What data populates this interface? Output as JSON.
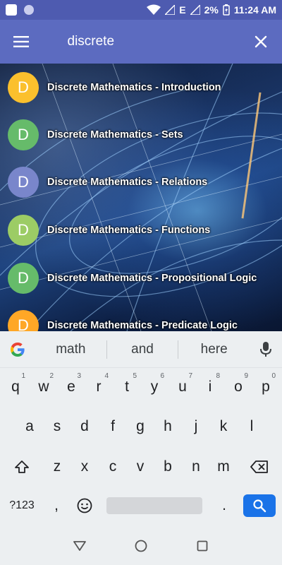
{
  "status_bar": {
    "network_label": "E",
    "battery": "2%",
    "time": "11:24 AM"
  },
  "app_bar": {
    "search_value": "discrete",
    "menu_icon": "hamburger-menu-icon",
    "close_icon": "close-icon"
  },
  "results": [
    {
      "initial": "D",
      "title": "Discrete Mathematics - Introduction",
      "color": "#fbc02d"
    },
    {
      "initial": "D",
      "title": "Discrete Mathematics - Sets",
      "color": "#66bb6a"
    },
    {
      "initial": "D",
      "title": "Discrete Mathematics - Relations",
      "color": "#7986cb"
    },
    {
      "initial": "D",
      "title": "Discrete Mathematics - Functions",
      "color": "#9ccc65"
    },
    {
      "initial": "D",
      "title": "Discrete Mathematics - Propositional Logic",
      "color": "#66bb6a"
    },
    {
      "initial": "D",
      "title": "Discrete Mathematics - Predicate Logic",
      "color": "#ffa726"
    }
  ],
  "keyboard": {
    "suggestions": [
      "math",
      "and",
      "here"
    ],
    "row1": [
      {
        "k": "q",
        "s": "1"
      },
      {
        "k": "w",
        "s": "2"
      },
      {
        "k": "e",
        "s": "3"
      },
      {
        "k": "r",
        "s": "4"
      },
      {
        "k": "t",
        "s": "5"
      },
      {
        "k": "y",
        "s": "6"
      },
      {
        "k": "u",
        "s": "7"
      },
      {
        "k": "i",
        "s": "8"
      },
      {
        "k": "o",
        "s": "9"
      },
      {
        "k": "p",
        "s": "0"
      }
    ],
    "row2": [
      "a",
      "s",
      "d",
      "f",
      "g",
      "h",
      "j",
      "k",
      "l"
    ],
    "row3": [
      "z",
      "x",
      "c",
      "v",
      "b",
      "n",
      "m"
    ],
    "symbols_label": "?123",
    "comma": ",",
    "period": "."
  },
  "colors": {
    "status_bar": "#4e5bb0",
    "app_bar": "#5c6bc0",
    "search_key": "#1a73e8"
  }
}
